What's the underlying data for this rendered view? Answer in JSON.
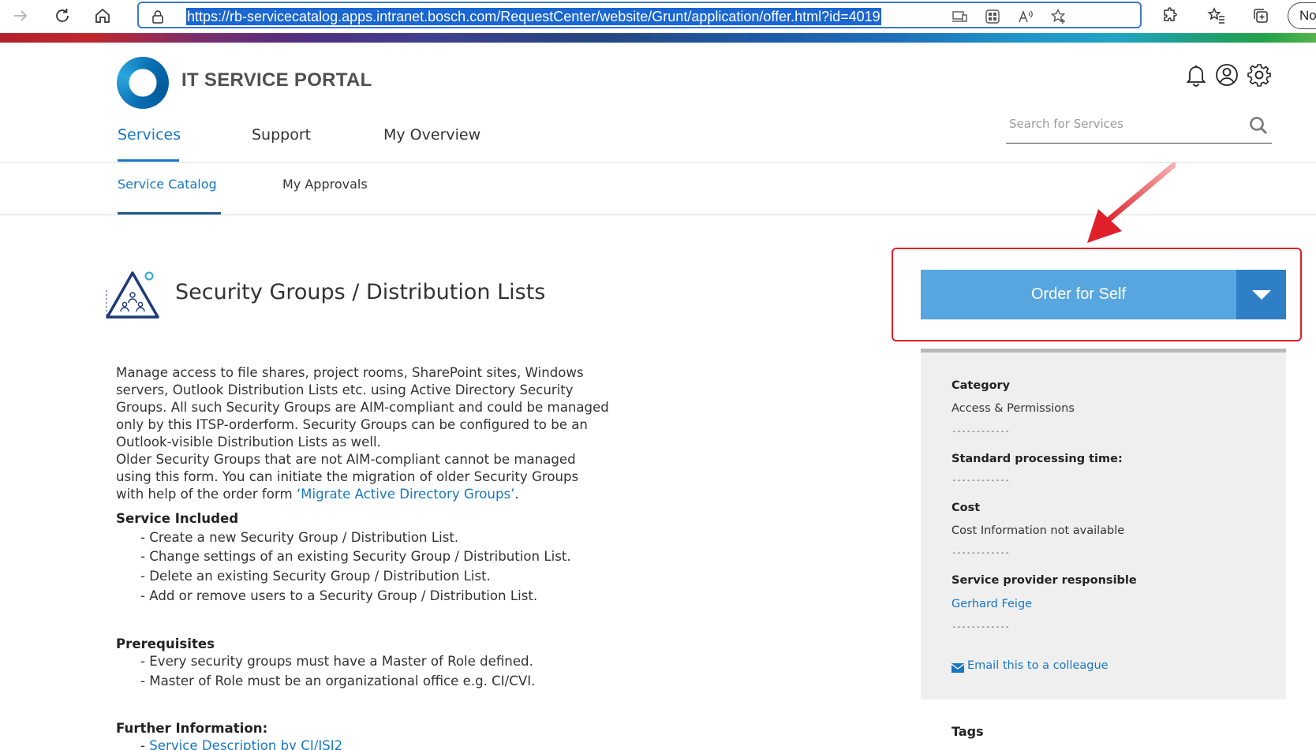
{
  "browser": {
    "url": "https://rb-servicecatalog.apps.intranet.bosch.com/RequestCenter/website/Grunt/application/offer.html?id=4019",
    "profile_label": "No"
  },
  "header": {
    "brand": "IT SERVICE PORTAL",
    "main_nav": [
      "Services",
      "Support",
      "My Overview"
    ],
    "sub_nav": [
      "Service Catalog",
      "My Approvals"
    ],
    "search": {
      "placeholder": "Search for Services"
    }
  },
  "offer": {
    "title": "Security Groups / Distribution Lists",
    "description_lines": [
      "Manage access to file shares, project rooms, SharePoint sites, Windows",
      "servers, Outlook Distribution Lists etc. using Active Directory Security",
      "Groups. All such Security Groups are AIM-compliant and could be managed",
      "only by this ITSP-orderform. Security Groups can be configured to be an",
      "Outlook-visible Distribution Lists as well.",
      "Older Security Groups that are not AIM-compliant cannot be managed",
      "using this form. You can initiate the migration of older Security Groups"
    ],
    "description_last_prefix": "with help of the order form ",
    "description_link": "‘Migrate Active Directory Groups’",
    "description_last_suffix": ".",
    "service_included_heading": "Service Included",
    "service_included": [
      "- Create a new Security Group / Distribution List.",
      "- Change settings of an existing Security Group / Distribution List.",
      "- Delete an existing Security Group / Distribution List.",
      "- Add or remove users to a Security Group / Distribution List."
    ],
    "prerequisites_heading": "Prerequisites",
    "prerequisites": [
      "- Every security groups must have a Master of Role defined.",
      "- Master of Role must be an organizational office e.g. CI/CVI."
    ],
    "further_info_heading": "Further Information:",
    "further_info_prefix": "- ",
    "further_info_link": "Service Description by CI/ISI2"
  },
  "order_panel": {
    "order_button": "Order for Self",
    "separator": "------------",
    "category_label": "Category",
    "category_value": "Access & Permissions",
    "processing_label": "Standard processing time:",
    "cost_label": "Cost",
    "cost_value": "Cost Information not available",
    "provider_label": "Service provider responsible",
    "provider_value": "Gerhard Feige",
    "email_link": "Email this to a colleague",
    "tags_label": "Tags"
  },
  "colors": {
    "accent": "#1877c2",
    "order_button": "#57a6e0",
    "order_dropdown": "#2f7fc7",
    "highlight": "#e0202a"
  }
}
